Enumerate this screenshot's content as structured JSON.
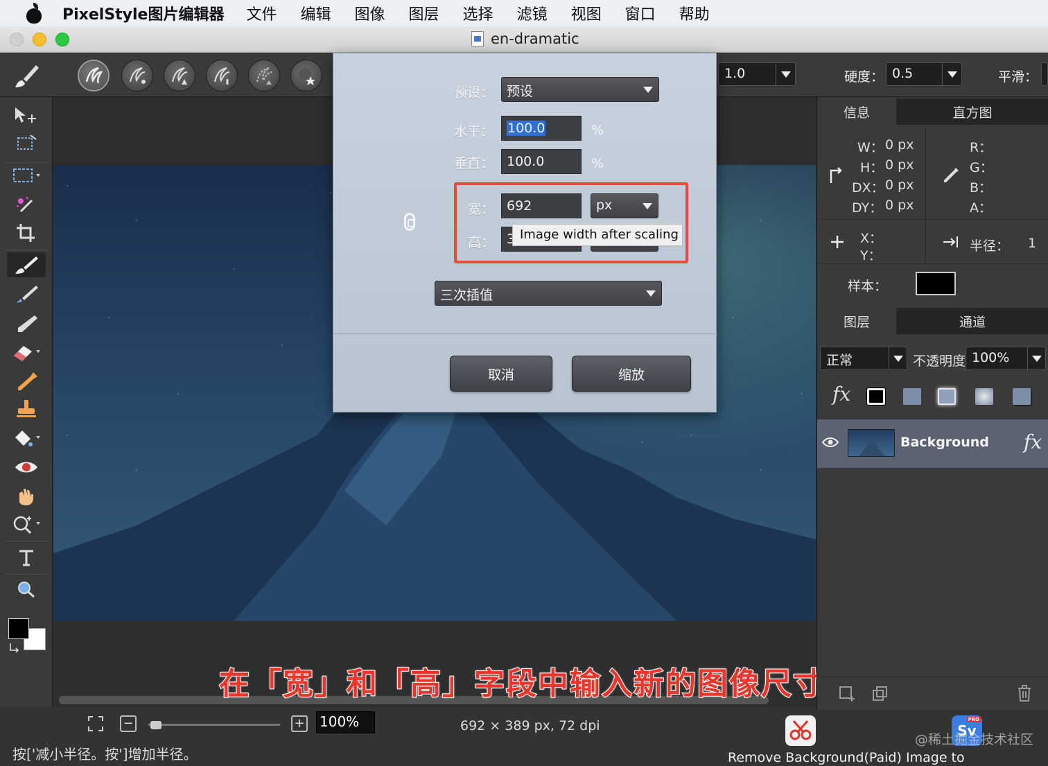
{
  "menubar": {
    "app_name": "PixelStyle图片编辑器",
    "menus": [
      "文件",
      "编辑",
      "图像",
      "图层",
      "选择",
      "滤镜",
      "视图",
      "窗口",
      "帮助"
    ]
  },
  "window": {
    "title": "en-dramatic"
  },
  "options": {
    "size_value": "1.0",
    "hardness_label": "硬度：",
    "hardness_value": "0.5",
    "smooth_label": "平滑："
  },
  "dialog": {
    "preset_label": "预设：",
    "preset_value": "预设",
    "horizontal_label": "水平：",
    "horizontal_value": "100.0",
    "vertical_label": "垂直：",
    "vertical_value": "100.0",
    "percent": "%",
    "width_label": "宽：",
    "width_value": "692",
    "unit_value": "px",
    "height_label": "高：",
    "height_value_partial": "3",
    "tooltip": "Image width after scaling",
    "interpolation_value": "三次插值",
    "cancel_label": "取消",
    "scale_label": "缩放"
  },
  "info_panel": {
    "tab_info": "信息",
    "tab_histogram": "直方图",
    "w_label": "W：",
    "w_value": "0 px",
    "h_label": "H：",
    "h_value": "0 px",
    "dx_label": "DX：",
    "dx_value": "0 px",
    "dy_label": "DY：",
    "dy_value": "0 px",
    "r_label": "R：",
    "g_label": "G：",
    "b_label": "B：",
    "a_label": "A：",
    "x_label": "X：",
    "y_label": "Y：",
    "radius_label": "半径：",
    "radius_value": "1",
    "sample_label": "样本："
  },
  "layers_panel": {
    "tab_layers": "图层",
    "tab_channels": "通道",
    "blend_mode": "正常",
    "opacity_label": "不透明度",
    "opacity_value": "100%",
    "fx_label": "fx",
    "layer_name": "Background",
    "layer_fx": "fx"
  },
  "statusbar": {
    "zoom_value": "100%",
    "dimensions": "692 × 389 px, 72 dpi",
    "hint": "按['减小半径。按']增加半径。",
    "remove_bg": "Remove Background(Paid)",
    "image_to_vector": "Image to Vector(Paid)",
    "watermark": "@稀土掘金技术社区",
    "sv_badge": "Sv",
    "pro_badge": "PRO"
  },
  "caption": "在「宽」和「高」字段中输入新的图像尺寸",
  "colors": {
    "highlight": "#e84a3c",
    "selection": "#2f6fd6",
    "caption": "#e8362c"
  }
}
